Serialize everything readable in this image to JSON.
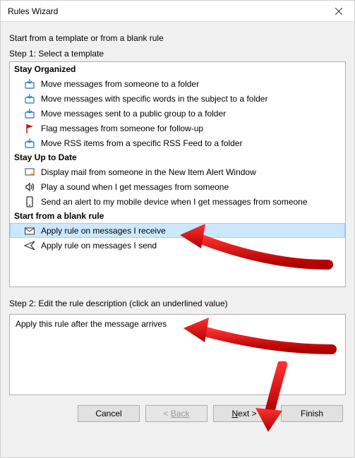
{
  "title": "Rules Wizard",
  "intro": "Start from a template or from a blank rule",
  "step1_label": "Step 1: Select a template",
  "step2_label": "Step 2: Edit the rule description (click an underlined value)",
  "categories": {
    "stay_organized": {
      "label": "Stay Organized",
      "items": [
        "Move messages from someone to a folder",
        "Move messages with specific words in the subject to a folder",
        "Move messages sent to a public group to a folder",
        "Flag messages from someone for follow-up",
        "Move RSS items from a specific RSS Feed to a folder"
      ]
    },
    "stay_up_to_date": {
      "label": "Stay Up to Date",
      "items": [
        "Display mail from someone in the New Item Alert Window",
        "Play a sound when I get messages from someone",
        "Send an alert to my mobile device when I get messages from someone"
      ]
    },
    "blank_rule": {
      "label": "Start from a blank rule",
      "items": [
        "Apply rule on messages I receive",
        "Apply rule on messages I send"
      ]
    }
  },
  "selected_template": "Apply rule on messages I receive",
  "description": "Apply this rule after the message arrives",
  "buttons": {
    "cancel": "Cancel",
    "back": "Back",
    "next": "Next >",
    "finish": "Finish",
    "back_prefix": "< "
  },
  "annotation": {
    "arrow_color": "#ff0000"
  }
}
